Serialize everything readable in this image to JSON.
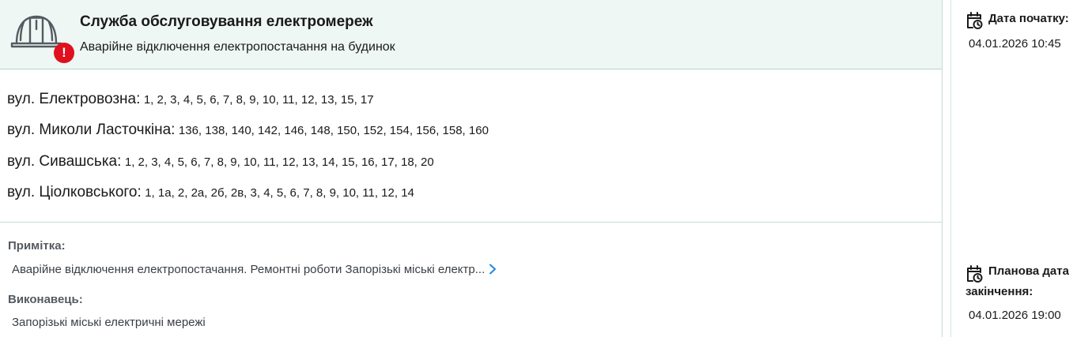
{
  "header": {
    "service_title": "Служба обслуговування електромереж",
    "outage_type": "Аварійне відключення електропостачання на будинок",
    "alert_symbol": "!",
    "helmet_icon": "hard-hat-icon",
    "alert_icon": "alert-icon",
    "colors": {
      "header_bg": "#eef7f4",
      "alert": "#e0101e",
      "link": "#1e88e5"
    }
  },
  "streets": [
    {
      "name": "вул. Електровозна:",
      "houses": "1, 2, 3, 4, 5, 6, 7, 8, 9, 10, 11, 12, 13, 15, 17"
    },
    {
      "name": "вул. Миколи Ласточкіна:",
      "houses": "136, 138, 140, 142, 146, 148, 150, 152, 154, 156, 158, 160"
    },
    {
      "name": "вул. Сивашська:",
      "houses": "1, 2, 3, 4, 5, 6, 7, 8, 9, 10, 11, 12, 13, 14, 15, 16, 17, 18, 20"
    },
    {
      "name": "вул. Ціолковського:",
      "houses": "1, 1а, 2, 2а, 2б, 2в, 3, 4, 5, 6, 7, 8, 9, 10, 11, 12, 14"
    }
  ],
  "note": {
    "label": "Примітка:",
    "text": "Аварійне відключення електропостачання. Ремонтні роботи Запорізькі міські електр..."
  },
  "executor": {
    "label": "Виконавець:",
    "text": "Запорізькі міські електричні мережі"
  },
  "side": {
    "start_label": "Дата початку:",
    "start_value": "04.01.2026 10:45",
    "end_label": "Планова дата закінчення:",
    "end_value": "04.01.2026 19:00",
    "calendar_icon": "calendar-clock-icon"
  }
}
